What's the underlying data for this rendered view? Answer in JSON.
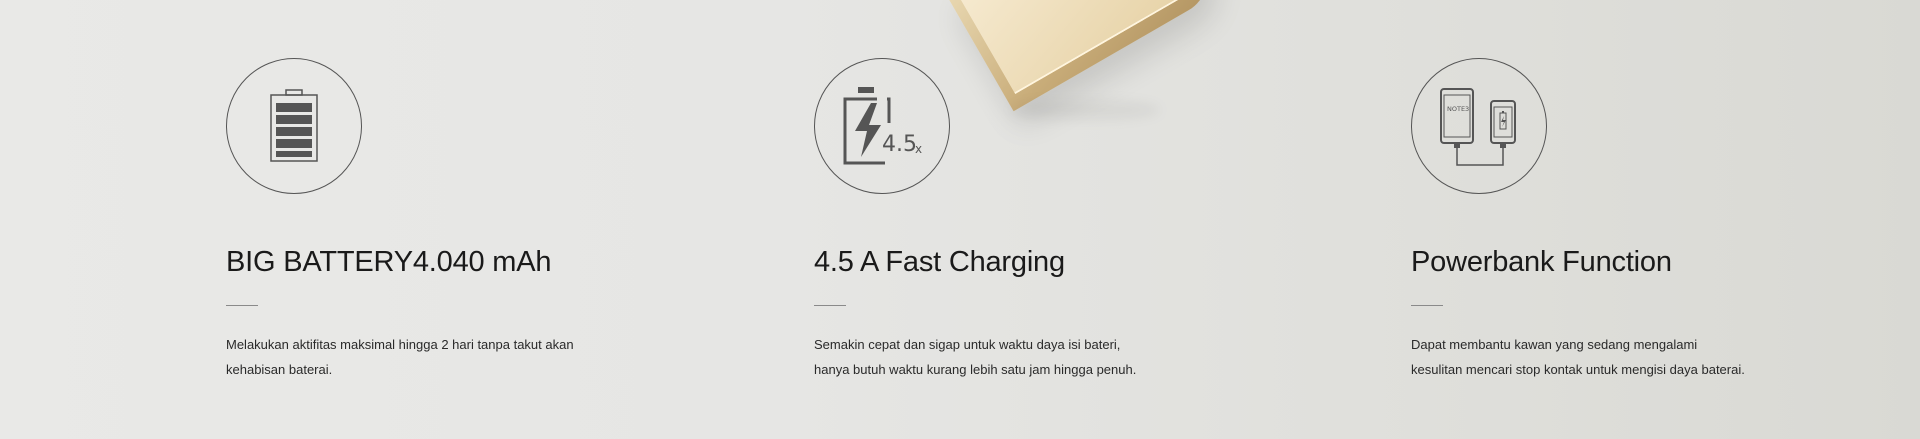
{
  "features": [
    {
      "icon": "battery-icon",
      "title": "BIG BATTERY4.040 mAh",
      "desc_lines": [
        "Melakukan aktifitas maksimal hingga 2 hari tanpa takut akan",
        "kehabisan baterai."
      ]
    },
    {
      "icon": "fast-charging-icon",
      "icon_label": "4.5",
      "icon_suffix": "x",
      "title": "4.5 A Fast Charging",
      "desc_lines": [
        "Semakin cepat dan sigap untuk waktu daya isi bateri,",
        "hanya butuh waktu kurang lebih satu jam hingga penuh."
      ]
    },
    {
      "icon": "powerbank-icon",
      "icon_label": "NOTE3",
      "title": "Powerbank Function",
      "desc_lines": [
        "Dapat membantu kawan yang sedang mengalami",
        "kesulitan mencari stop kontak untuk mengisi daya baterai."
      ]
    }
  ],
  "colors": {
    "icon_stroke": "#555555",
    "text": "#1a1a1a",
    "phone_gold": "#c9ad7a"
  }
}
